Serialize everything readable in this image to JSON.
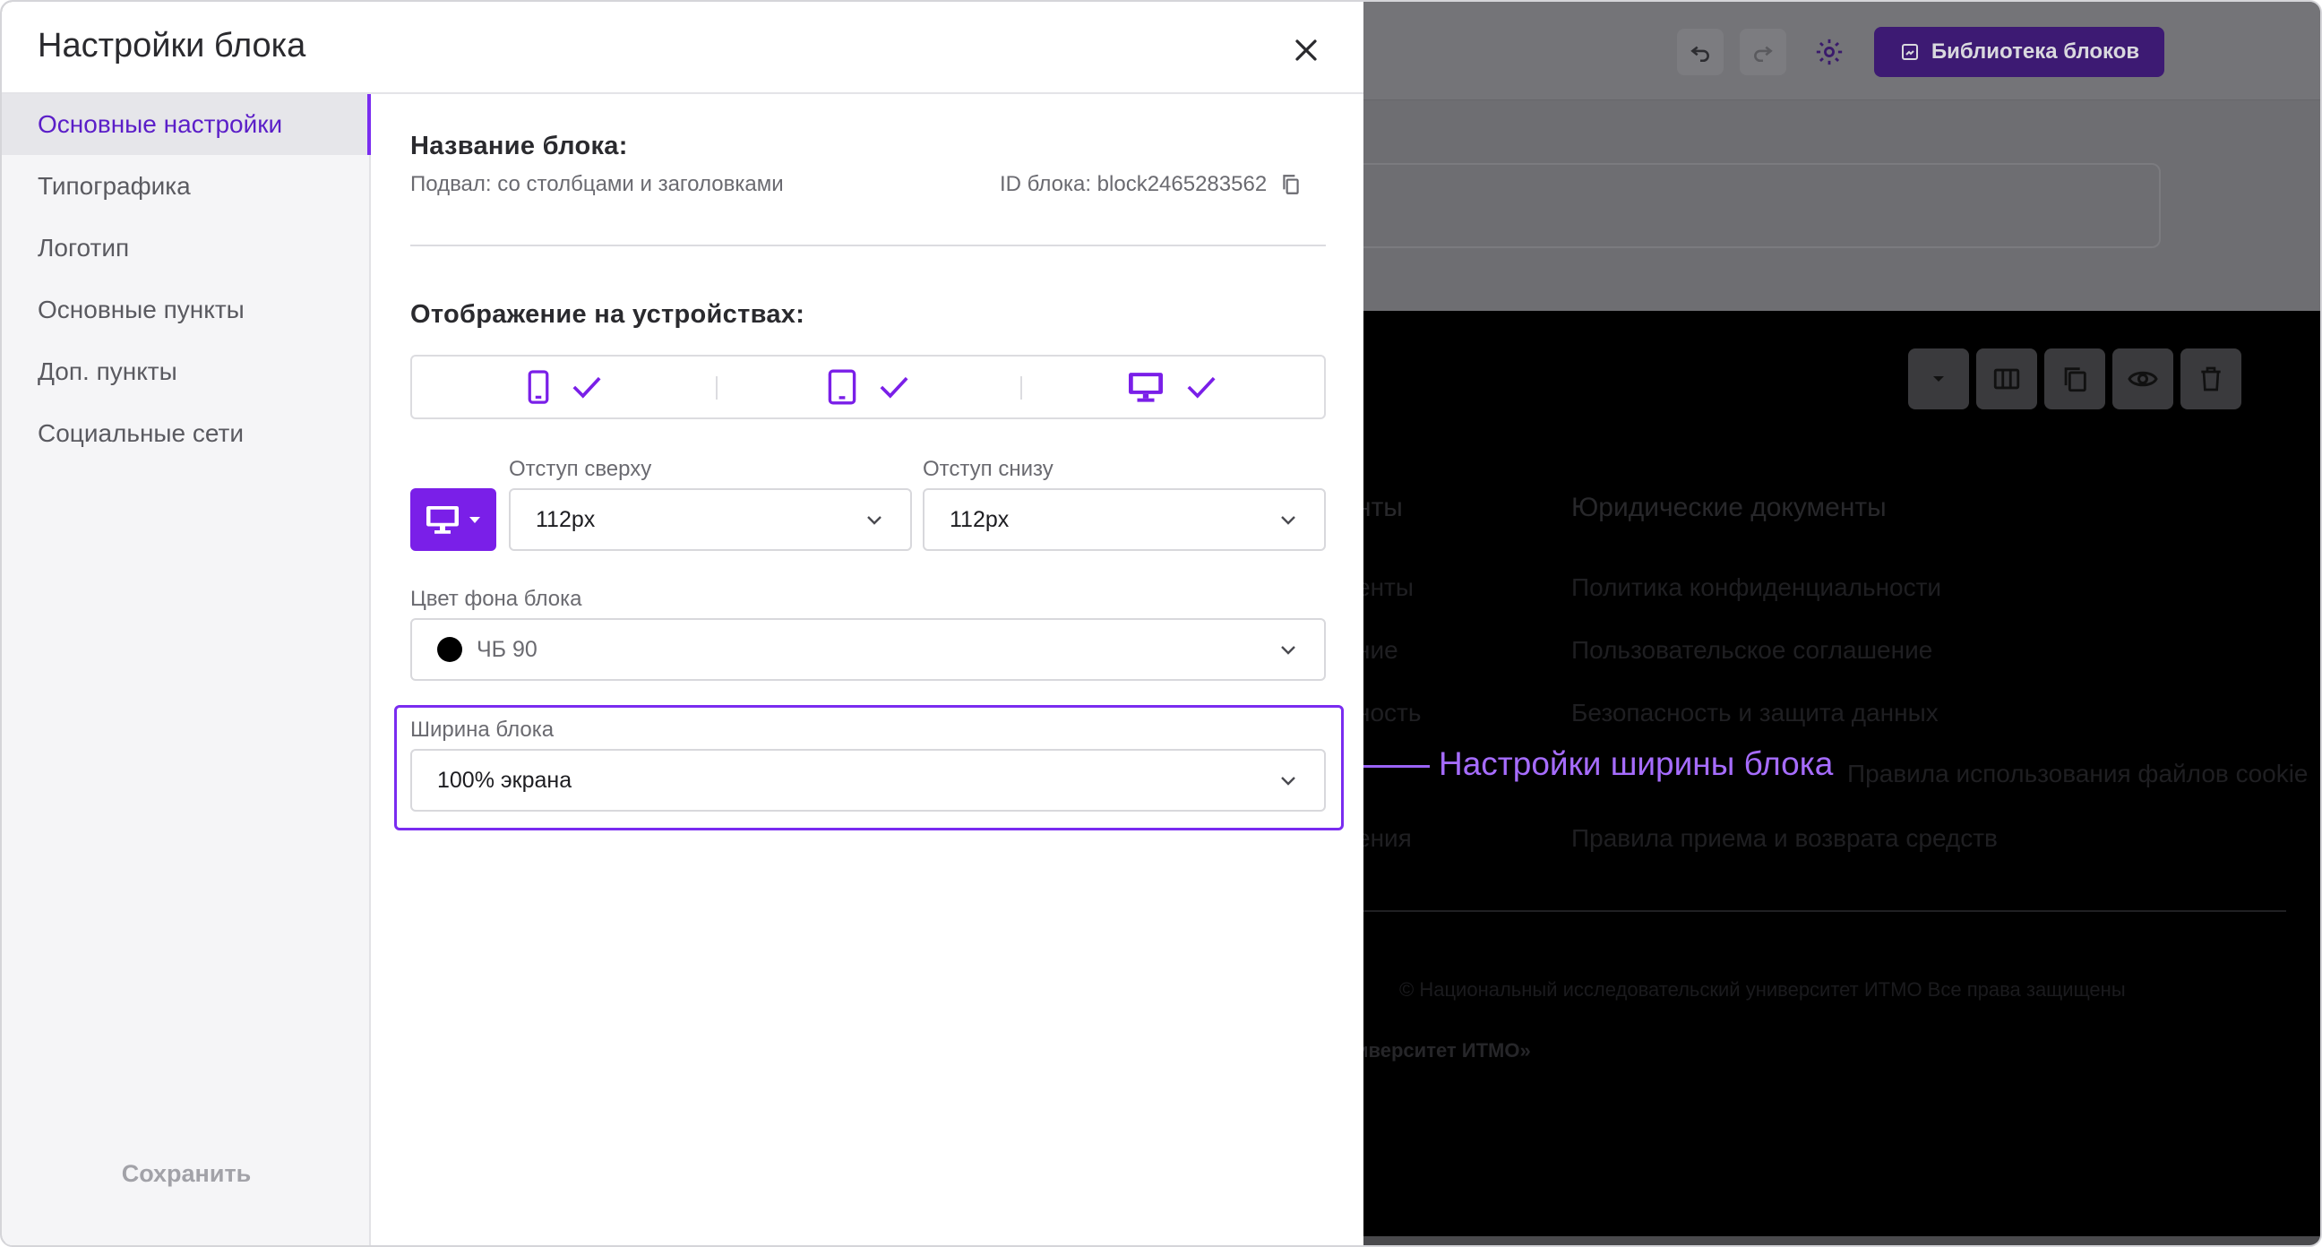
{
  "modal": {
    "title": "Настройки блока",
    "close_icon": "close-icon"
  },
  "sidebar": {
    "items": [
      {
        "label": "Основные настройки",
        "active": true
      },
      {
        "label": "Типографика",
        "active": false
      },
      {
        "label": "Логотип",
        "active": false
      },
      {
        "label": "Основные пункты",
        "active": false
      },
      {
        "label": "Доп. пункты",
        "active": false
      },
      {
        "label": "Социальные сети",
        "active": false
      }
    ],
    "save_label": "Сохранить"
  },
  "content": {
    "block_name_label": "Название блока:",
    "block_name_value": "Подвал: со столбцами и заголовками",
    "block_id": "ID блока: block2465283562",
    "devices_label": "Отображение на устройствах:",
    "devices": [
      {
        "icon": "mobile-icon",
        "checked": true
      },
      {
        "icon": "tablet-icon",
        "checked": true
      },
      {
        "icon": "desktop-icon",
        "checked": true
      }
    ],
    "padding_top_label": "Отступ сверху",
    "padding_top_value": "112px",
    "padding_bottom_label": "Отступ снизу",
    "padding_bottom_value": "112px",
    "bg_color_label": "Цвет фона блока",
    "bg_color_value": "ЧБ 90",
    "bg_color_hex": "#000000",
    "width_label": "Ширина блока",
    "width_value": "100% экрана"
  },
  "annotation": {
    "text": "Настройки ширины блока",
    "color": "#a66cff"
  },
  "background": {
    "library_button": "Библиотека блоков",
    "col_heading_partial": "нты",
    "col_heading": "Юридические документы",
    "col1_items": [
      "енты",
      "ние",
      "ность",
      "ения"
    ],
    "col2_items": [
      "Политика конфиденциальности",
      "Пользовательское соглашение",
      "Безопасность и защита данных",
      "Правила использования файлов cookie",
      "Правила приема и возврата средств"
    ],
    "footer_line1": "© Национальный исследовательский университет ИТМО   Все права защищены",
    "footer_line2": "иверситет ИТМО»"
  },
  "colors": {
    "accent": "#7a1fe8",
    "accent_text": "#5b1ec8",
    "dim_overlay": "#6e6e72"
  }
}
